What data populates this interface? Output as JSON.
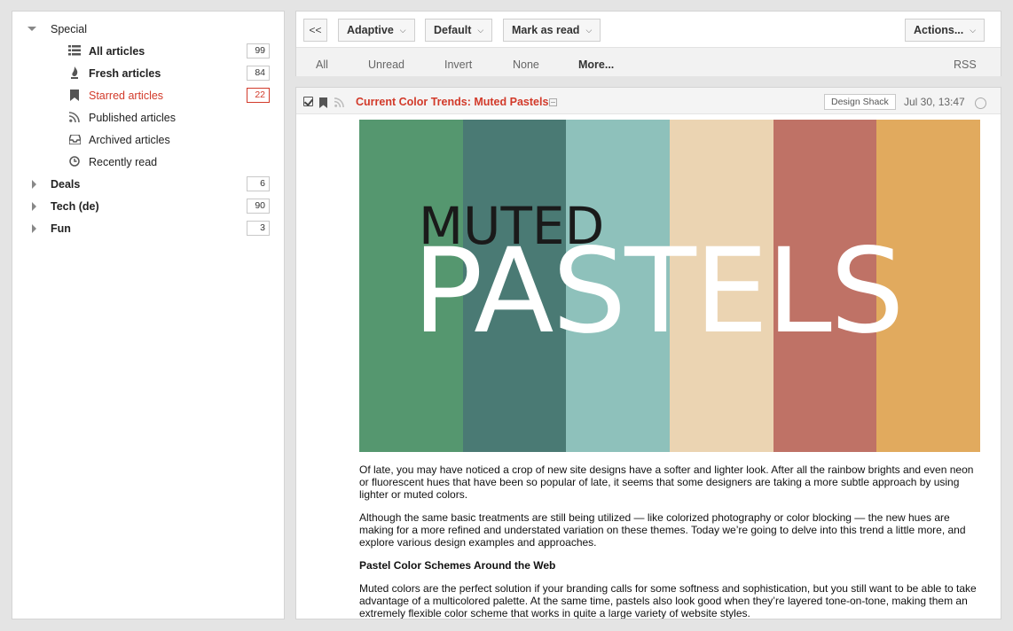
{
  "sidebar": {
    "special": {
      "label": "Special"
    },
    "feeds": [
      {
        "label": "All articles",
        "count": "99",
        "icon": "list-icon"
      },
      {
        "label": "Fresh articles",
        "count": "84",
        "icon": "flame-icon"
      },
      {
        "label": "Starred articles",
        "count": "22",
        "icon": "bookmark-icon"
      },
      {
        "label": "Published articles",
        "icon": "rss-icon"
      },
      {
        "label": "Archived articles",
        "icon": "inbox-icon"
      },
      {
        "label": "Recently read",
        "icon": "clock-icon"
      }
    ],
    "categories": [
      {
        "label": "Deals",
        "count": "6"
      },
      {
        "label": "Tech (de)",
        "count": "90"
      },
      {
        "label": "Fun",
        "count": "3"
      }
    ]
  },
  "toolbar": {
    "collapse_label": "<<",
    "view_mode": "Adaptive",
    "order": "Default",
    "mark_read": "Mark as read",
    "actions": "Actions..."
  },
  "filters": {
    "all": "All",
    "unread": "Unread",
    "invert": "Invert",
    "none": "None",
    "more": "More...",
    "rss": "RSS"
  },
  "article": {
    "title": "Current Color Trends: Muted Pastels",
    "feed": "Design Shack",
    "date": "Jul 30, 13:47",
    "hero_small": "MUTED",
    "hero_big": "PASTELS",
    "hero_colors": [
      "#55976f",
      "#4a7a74",
      "#8ec1bb",
      "#ebd4b2",
      "#bf7266",
      "#e1aa5e"
    ],
    "paragraphs": [
      "Of late, you may have noticed a crop of new site designs have a softer and lighter look. After all the rainbow brights and even neon or fluorescent hues that have been so popular of late, it seems that some designers are taking a more subtle approach by using lighter or muted colors.",
      "Although the same basic treatments are still being utilized — like colorized photography or color blocking — the new hues are making for a more refined and understated variation on these themes. Today we’re going to delve into this trend a little more, and explore various design examples and approaches."
    ],
    "subheading": "Pastel Color Schemes Around the Web",
    "paragraph3": "Muted colors are the perfect solution if your branding calls for some softness and sophistication, but you still want to be able to take advantage of a multicolored palette. At the same time, pastels also look good when they’re layered tone-on-tone, making them an extremely flexible color scheme that works in quite a large variety of website styles."
  }
}
